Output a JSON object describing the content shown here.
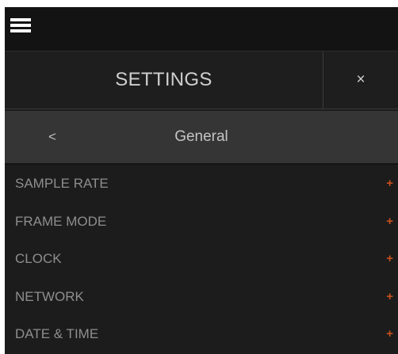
{
  "topbar": {
    "menu_icon": "hamburger-menu-icon"
  },
  "settings": {
    "title": "SETTINGS",
    "close_label": "×"
  },
  "subheader": {
    "back_label": "<",
    "title": "General"
  },
  "menu": {
    "items": [
      {
        "label": "SAMPLE RATE",
        "expand_icon": "+"
      },
      {
        "label": "FRAME MODE",
        "expand_icon": "+"
      },
      {
        "label": "CLOCK",
        "expand_icon": "+"
      },
      {
        "label": "NETWORK",
        "expand_icon": "+"
      },
      {
        "label": "DATE & TIME",
        "expand_icon": "+"
      }
    ]
  },
  "colors": {
    "accent": "#c8501e",
    "background": "#1c1c1c",
    "subheader_bg": "#353535",
    "topbar_bg": "#131313",
    "text_primary": "#cfcfcf",
    "text_muted": "#8e8e8e"
  }
}
